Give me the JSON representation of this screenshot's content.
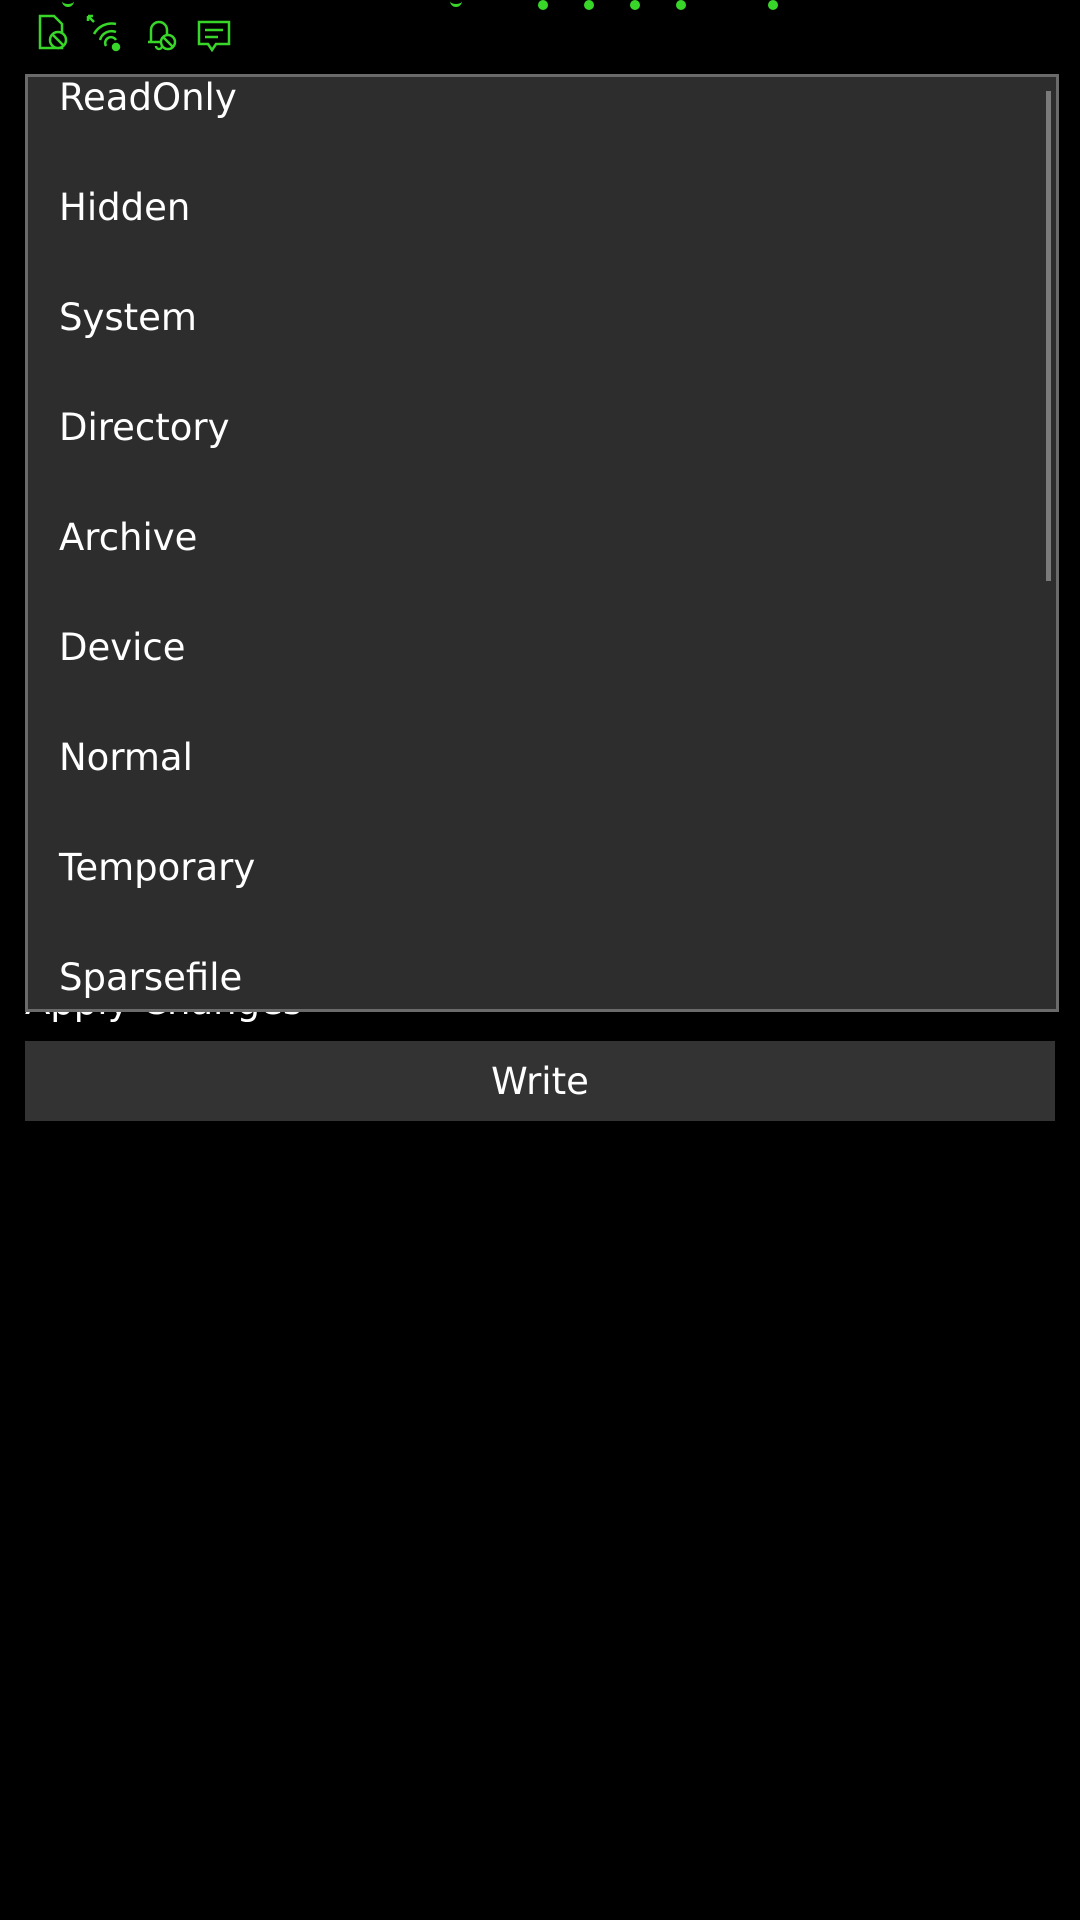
{
  "status_bar": {
    "accent_color": "#39d62a",
    "icons": [
      "no-sim-icon",
      "wifi-icon",
      "notifications-off-icon",
      "message-icon"
    ]
  },
  "dropdown": {
    "items": [
      {
        "label": "ReadOnly"
      },
      {
        "label": "Hidden"
      },
      {
        "label": "System"
      },
      {
        "label": "Directory"
      },
      {
        "label": "Archive"
      },
      {
        "label": "Device"
      },
      {
        "label": "Normal"
      },
      {
        "label": "Temporary"
      },
      {
        "label": "Sparsefile"
      }
    ]
  },
  "section": {
    "label": "Apply Changes"
  },
  "write_button": {
    "label": "Write"
  }
}
